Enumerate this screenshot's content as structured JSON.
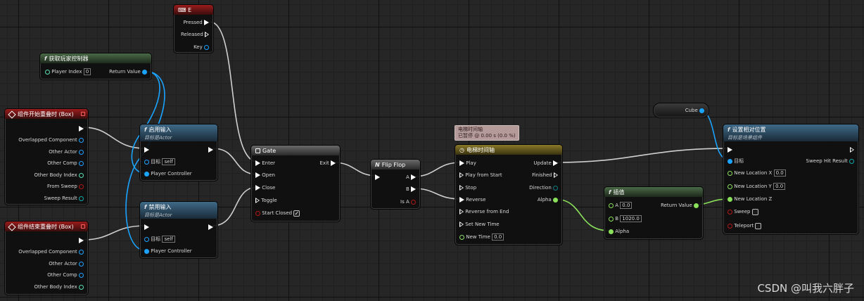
{
  "colors": {
    "exec": "#ffffff",
    "object": "#1aa3ff",
    "int": "#5ce0b0",
    "float": "#8ae05a",
    "bool": "#b01818",
    "vector": "#f5d531",
    "struct": "#10a8a8"
  },
  "nodes": {
    "key_e": {
      "title": "E",
      "icon": "keyboard-icon",
      "pins": {
        "pressed": "Pressed",
        "released": "Released",
        "key": "Key"
      }
    },
    "get_player_controller": {
      "title": "获取玩家控制器",
      "pins": {
        "player_index": "Player Index",
        "player_index_value": "0",
        "return_value": "Return Value"
      }
    },
    "begin_overlap": {
      "title": "组件开始重叠时 (Box)",
      "pins": {
        "overlapped_component": "Overlapped Component",
        "other_actor": "Other Actor",
        "other_comp": "Other Comp",
        "other_body_index": "Other Body Index",
        "from_sweep": "From Sweep",
        "sweep_result": "Sweep Result"
      }
    },
    "end_overlap": {
      "title": "组件结束重叠时 (Box)",
      "pins": {
        "overlapped_component": "Overlapped Component",
        "other_actor": "Other Actor",
        "other_comp": "Other Comp",
        "other_body_index": "Other Body Index"
      }
    },
    "enable_input": {
      "title": "启用输入",
      "subtitle": "目标是Actor",
      "pins": {
        "target": "目标",
        "target_value": "self",
        "player_controller": "Player Controller"
      }
    },
    "disable_input": {
      "title": "禁用输入",
      "subtitle": "目标是Actor",
      "pins": {
        "target": "目标",
        "target_value": "self",
        "player_controller": "Player Controller"
      }
    },
    "gate": {
      "title": "Gate",
      "pins": {
        "enter": "Enter",
        "open": "Open",
        "close": "Close",
        "toggle": "Toggle",
        "start_closed": "Start Closed",
        "exit": "Exit"
      }
    },
    "flip_flop": {
      "title": "Flip Flop",
      "pins": {
        "a": "A",
        "b": "B",
        "is_a": "Is A"
      }
    },
    "timeline": {
      "tooltip_title": "电梯时间轴",
      "tooltip_status": "已暂停 @ 0.00 s (0.0 %)",
      "title": "电梯时间轴",
      "pins": {
        "play": "Play",
        "play_from_start": "Play from Start",
        "stop": "Stop",
        "reverse": "Reverse",
        "reverse_from_end": "Reverse from End",
        "set_new_time": "Set New Time",
        "new_time": "New Time",
        "new_time_value": "0.0",
        "update": "Update",
        "finished": "Finished",
        "direction": "Direction",
        "alpha": "Alpha"
      }
    },
    "cube": {
      "label": "Cube"
    },
    "lerp": {
      "title": "插值",
      "pins": {
        "a": "A",
        "a_value": "0.0",
        "b": "B",
        "b_value": "1020.0",
        "alpha": "Alpha",
        "return_value": "Return Value"
      }
    },
    "set_relative_location": {
      "title": "设置相对位置",
      "subtitle": "目标是场景组件",
      "pins": {
        "target": "目标",
        "new_location_x": "New Location X",
        "x_value": "0.0",
        "new_location_y": "New Location Y",
        "y_value": "0.0",
        "new_location_z": "New Location Z",
        "sweep": "Sweep",
        "teleport": "Teleport",
        "sweep_hit_result": "Sweep Hit Result"
      }
    }
  },
  "watermark": "CSDN @叫我六胖子"
}
